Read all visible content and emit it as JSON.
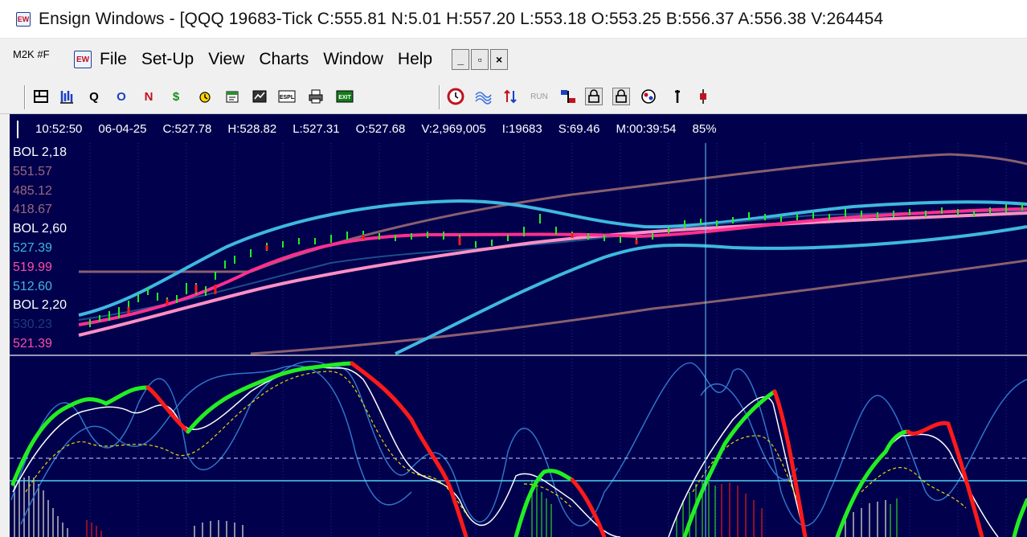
{
  "window": {
    "title": "Ensign Windows - [QQQ 19683-Tick C:555.81 N:5.01 H:557.20 L:553.18 O:553.25 B:556.37 A:556.38 V:264454",
    "app_icon_text": "EW"
  },
  "menubar": {
    "left_label": "M2K #F",
    "items": [
      "File",
      "Set-Up",
      "View",
      "Charts",
      "Window",
      "Help"
    ],
    "window_controls": [
      "_",
      "▫",
      "×"
    ]
  },
  "toolbar": {
    "run_label": "RUN",
    "espl_label": "ESPL",
    "exit_label": "EXIT",
    "quote_buttons": [
      "Q",
      "O",
      "N",
      "$"
    ],
    "accent": "#1a3fc4"
  },
  "info": {
    "time": "10:52:50",
    "date": "06-04-25",
    "close": "C:527.78",
    "high": "H:528.82",
    "low": "L:527.31",
    "open": "O:527.68",
    "volume": "V:2,969,005",
    "interval": "I:19683",
    "s_value": "S:69.46",
    "minutes": "M:00:39:54",
    "percent": "85%"
  },
  "studies": [
    {
      "text": "BOL  2,18",
      "color": "#ffffff"
    },
    {
      "text": "551.57",
      "color": "#9b6a7a"
    },
    {
      "text": "485.12",
      "color": "#9b6a7a"
    },
    {
      "text": "418.67",
      "color": "#9b6a7a"
    },
    {
      "text": "BOL  2,60",
      "color": "#ffffff"
    },
    {
      "text": "527.39",
      "color": "#3fb8e0"
    },
    {
      "text": "519.99",
      "color": "#ff4fa0"
    },
    {
      "text": "512.60",
      "color": "#3fb8e0"
    },
    {
      "text": "BOL  2,20",
      "color": "#ffffff"
    },
    {
      "text": "530.23",
      "color": "#1f3a7a"
    },
    {
      "text": "521.39",
      "color": "#ff4fa0"
    }
  ],
  "colors": {
    "chart_bg": "#00004d",
    "band_outer": "#8a5f6e",
    "band_mid": "#3fb8e0",
    "center_line": "#ff2f8f",
    "center_pink": "#ff8fc4",
    "osc_up": "#22ee22",
    "osc_down": "#ff1a1a",
    "crosshair": "#6fd0ff"
  }
}
